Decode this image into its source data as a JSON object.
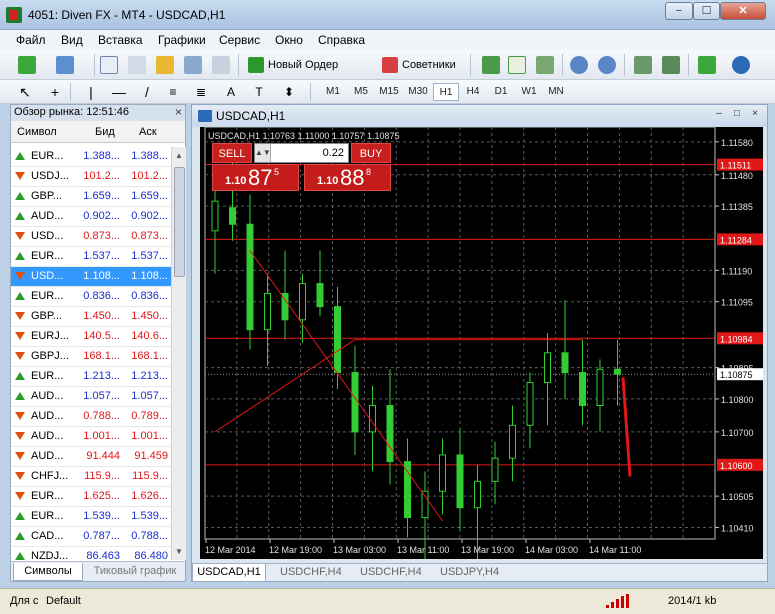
{
  "window": {
    "title": "4051: Diven FX - MT4 - USDCAD,H1",
    "min": "−",
    "max": "☐",
    "close": "✕"
  },
  "menu": [
    "Файл",
    "Вид",
    "Вставка",
    "Графики",
    "Сервис",
    "Окно",
    "Справка"
  ],
  "toolbar": {
    "new_order": "Новый Ордер",
    "advisors": "Советники"
  },
  "timeframes": [
    "M1",
    "M5",
    "M15",
    "M30",
    "H1",
    "H4",
    "D1",
    "W1",
    "MN"
  ],
  "active_timeframe": "H1",
  "market_watch": {
    "title": "Обзор рынка: 12:51:46",
    "columns": {
      "symbol": "Символ",
      "bid": "Бид",
      "ask": "Аск"
    },
    "rows": [
      {
        "dir": "up",
        "symbol": "EUR...",
        "bid": "1.388...",
        "ask": "1.388...",
        "color": "blue"
      },
      {
        "dir": "down",
        "symbol": "USDJ...",
        "bid": "101.2...",
        "ask": "101.2...",
        "color": "red"
      },
      {
        "dir": "up",
        "symbol": "GBP...",
        "bid": "1.659...",
        "ask": "1.659...",
        "color": "blue"
      },
      {
        "dir": "up",
        "symbol": "AUD...",
        "bid": "0.902...",
        "ask": "0.902...",
        "color": "blue"
      },
      {
        "dir": "down",
        "symbol": "USD...",
        "bid": "0.873...",
        "ask": "0.873...",
        "color": "red"
      },
      {
        "dir": "up",
        "symbol": "EUR...",
        "bid": "1.537...",
        "ask": "1.537...",
        "color": "blue"
      },
      {
        "dir": "down",
        "symbol": "USD...",
        "bid": "1.108...",
        "ask": "1.108...",
        "color": "red",
        "selected": true
      },
      {
        "dir": "up",
        "symbol": "EUR...",
        "bid": "0.836...",
        "ask": "0.836...",
        "color": "blue"
      },
      {
        "dir": "down",
        "symbol": "GBP...",
        "bid": "1.450...",
        "ask": "1.450...",
        "color": "red"
      },
      {
        "dir": "down",
        "symbol": "EURJ...",
        "bid": "140.5...",
        "ask": "140.6...",
        "color": "red"
      },
      {
        "dir": "down",
        "symbol": "GBPJ...",
        "bid": "168.1...",
        "ask": "168.1...",
        "color": "red"
      },
      {
        "dir": "up",
        "symbol": "EUR...",
        "bid": "1.213...",
        "ask": "1.213...",
        "color": "blue"
      },
      {
        "dir": "up",
        "symbol": "AUD...",
        "bid": "1.057...",
        "ask": "1.057...",
        "color": "blue"
      },
      {
        "dir": "down",
        "symbol": "AUD...",
        "bid": "0.788...",
        "ask": "0.789...",
        "color": "red"
      },
      {
        "dir": "down",
        "symbol": "AUD...",
        "bid": "1.001...",
        "ask": "1.001...",
        "color": "red"
      },
      {
        "dir": "down",
        "symbol": "AUD...",
        "bid": "91.444",
        "ask": "91.459",
        "color": "red"
      },
      {
        "dir": "down",
        "symbol": "CHFJ...",
        "bid": "115.9...",
        "ask": "115.9...",
        "color": "red"
      },
      {
        "dir": "down",
        "symbol": "EUR...",
        "bid": "1.625...",
        "ask": "1.626...",
        "color": "red"
      },
      {
        "dir": "up",
        "symbol": "EUR...",
        "bid": "1.539...",
        "ask": "1.539...",
        "color": "blue"
      },
      {
        "dir": "up",
        "symbol": "CAD...",
        "bid": "0.787...",
        "ask": "0.788...",
        "color": "blue"
      },
      {
        "dir": "up",
        "symbol": "NZDJ...",
        "bid": "86.463",
        "ask": "86.480",
        "color": "blue"
      }
    ],
    "tabs": [
      "Символы",
      "Тиковый график"
    ]
  },
  "chart": {
    "window_title": "USDCAD,H1",
    "info_line": "USDCAD,H1  1.10763 1.11000 1.10757 1.10875",
    "trade": {
      "sell_label": "SELL",
      "buy_label": "BUY",
      "lot": "0.22",
      "sell_prefix": "1.10",
      "sell_big": "87",
      "sell_sup": "5",
      "buy_prefix": "1.10",
      "buy_big": "88",
      "buy_sup": "8"
    },
    "price_labels": [
      "1.11580",
      "1.11480",
      "1.11385",
      "1.11190",
      "1.11095",
      "1.10895",
      "1.10800",
      "1.10700",
      "1.10505",
      "1.10410"
    ],
    "highlight_labels": [
      {
        "text": "1.11511",
        "color": "#e01818"
      },
      {
        "text": "1.11284",
        "color": "#e01818"
      },
      {
        "text": "1.10984",
        "color": "#e01818"
      },
      {
        "text": "1.10875",
        "color": "#ffffff"
      },
      {
        "text": "1.10600",
        "color": "#e01818"
      }
    ],
    "time_labels": [
      "12 Mar 2014",
      "12 Mar 19:00",
      "13 Mar 03:00",
      "13 Mar 11:00",
      "13 Mar 19:00",
      "14 Mar 03:00",
      "14 Mar 11:00"
    ],
    "tabs": [
      "USDCAD,H1",
      "USDCHF,H4",
      "USDCHF,H4",
      "USDJPY,H4"
    ],
    "colors": {
      "bull": "#33cc33",
      "grid": "#5a5a5a",
      "hline": "#e01818",
      "trend": "#e01818"
    }
  },
  "chart_data": {
    "type": "candlestick",
    "title": "USDCAD,H1",
    "ylim": [
      1.10375,
      1.11625
    ],
    "price_ticks": [
      1.1158,
      1.1148,
      1.11385,
      1.1119,
      1.11095,
      1.10895,
      1.108,
      1.107,
      1.10505,
      1.1041
    ],
    "horizontal_lines": [
      1.11511,
      1.11284,
      1.10984,
      1.106
    ],
    "last_price": 1.10875,
    "ohlc": [
      [
        1.1131,
        1.1145,
        1.1118,
        1.114
      ],
      [
        1.1138,
        1.1152,
        1.1128,
        1.1133
      ],
      [
        1.1133,
        1.1142,
        1.1095,
        1.1101
      ],
      [
        1.1101,
        1.1118,
        1.109,
        1.1112
      ],
      [
        1.1112,
        1.1125,
        1.1098,
        1.1104
      ],
      [
        1.1104,
        1.1118,
        1.1097,
        1.1115
      ],
      [
        1.1115,
        1.1125,
        1.1105,
        1.1108
      ],
      [
        1.1108,
        1.1114,
        1.1083,
        1.1088
      ],
      [
        1.1088,
        1.1096,
        1.1063,
        1.107
      ],
      [
        1.107,
        1.1084,
        1.1058,
        1.1078
      ],
      [
        1.1078,
        1.1089,
        1.1054,
        1.1061
      ],
      [
        1.1061,
        1.1068,
        1.1038,
        1.1044
      ],
      [
        1.1044,
        1.1058,
        1.1031,
        1.1052
      ],
      [
        1.1052,
        1.1068,
        1.1045,
        1.1063
      ],
      [
        1.1063,
        1.1071,
        1.104,
        1.1047
      ],
      [
        1.1047,
        1.106,
        1.103,
        1.1055
      ],
      [
        1.1055,
        1.1067,
        1.1048,
        1.1062
      ],
      [
        1.1062,
        1.1078,
        1.1055,
        1.1072
      ],
      [
        1.1072,
        1.1088,
        1.1065,
        1.1085
      ],
      [
        1.1085,
        1.11,
        1.1072,
        1.1094
      ],
      [
        1.1094,
        1.111,
        1.108,
        1.1088
      ],
      [
        1.1088,
        1.1098,
        1.1072,
        1.1078
      ],
      [
        1.1078,
        1.1092,
        1.107,
        1.1089
      ],
      [
        1.1089,
        1.1098,
        1.1078,
        1.10875
      ]
    ],
    "trendlines": [
      {
        "from": [
          0,
          1.107
        ],
        "to": [
          8,
          1.1098
        ]
      },
      {
        "from": [
          8,
          1.1098
        ],
        "to": [
          21,
          1.1098
        ]
      },
      {
        "from": [
          2,
          1.1125
        ],
        "to": [
          13,
          1.1043
        ]
      }
    ]
  },
  "statusbar": {
    "help": "Для с",
    "profile": "Default",
    "traffic": "2014/1 kb"
  }
}
